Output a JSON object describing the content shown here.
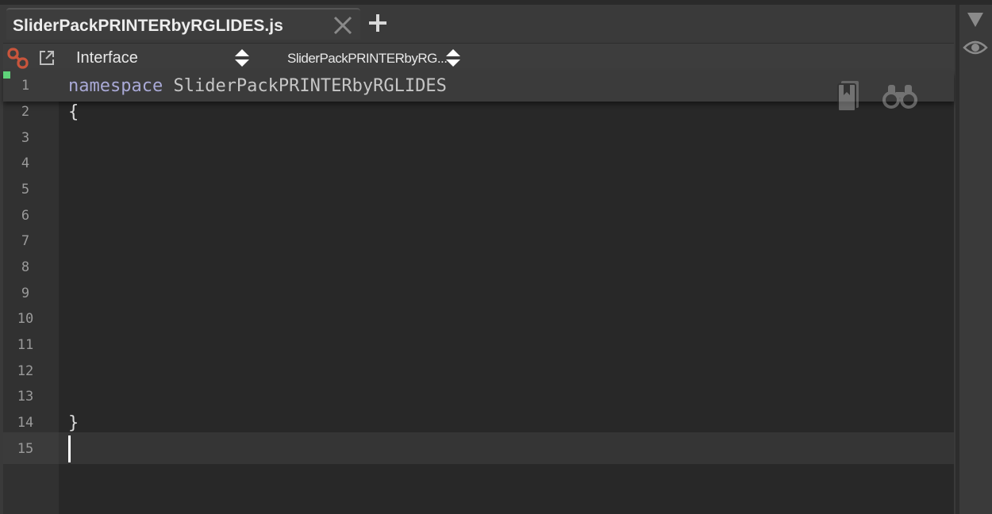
{
  "tab": {
    "title": "SliderPackPRINTERbyRGLIDES.js"
  },
  "toolbar": {
    "namespace_selector": "Interface",
    "function_selector": "SliderPackPRINTERbyRG..."
  },
  "editor": {
    "lines": [
      {
        "number": "1",
        "keyword": "namespace",
        "text": " SliderPackPRINTERbyRGLIDES"
      },
      {
        "number": "2",
        "text": "{"
      },
      {
        "number": "3",
        "text": ""
      },
      {
        "number": "4",
        "text": ""
      },
      {
        "number": "5",
        "text": ""
      },
      {
        "number": "6",
        "text": ""
      },
      {
        "number": "7",
        "text": ""
      },
      {
        "number": "8",
        "text": ""
      },
      {
        "number": "9",
        "text": ""
      },
      {
        "number": "10",
        "text": ""
      },
      {
        "number": "11",
        "text": ""
      },
      {
        "number": "12",
        "text": ""
      },
      {
        "number": "13",
        "text": ""
      },
      {
        "number": "14",
        "text": "}"
      },
      {
        "number": "15",
        "text": ""
      }
    ],
    "current_line": "15"
  },
  "icons": {
    "tab_close": "close-icon",
    "add_tab": "plus-icon",
    "link": "link-icon",
    "popout": "external-link-icon",
    "sort": "sort-updown-icon",
    "bookmark": "bookmark-icon",
    "search": "binoculars-icon",
    "collapse": "triangle-down-icon",
    "visibility": "eye-icon"
  },
  "colors": {
    "background": "#282828",
    "gutter": "#313131",
    "keyword": "#a9a9d6",
    "link_accent": "#c9553c",
    "marker": "#5fd37a"
  }
}
